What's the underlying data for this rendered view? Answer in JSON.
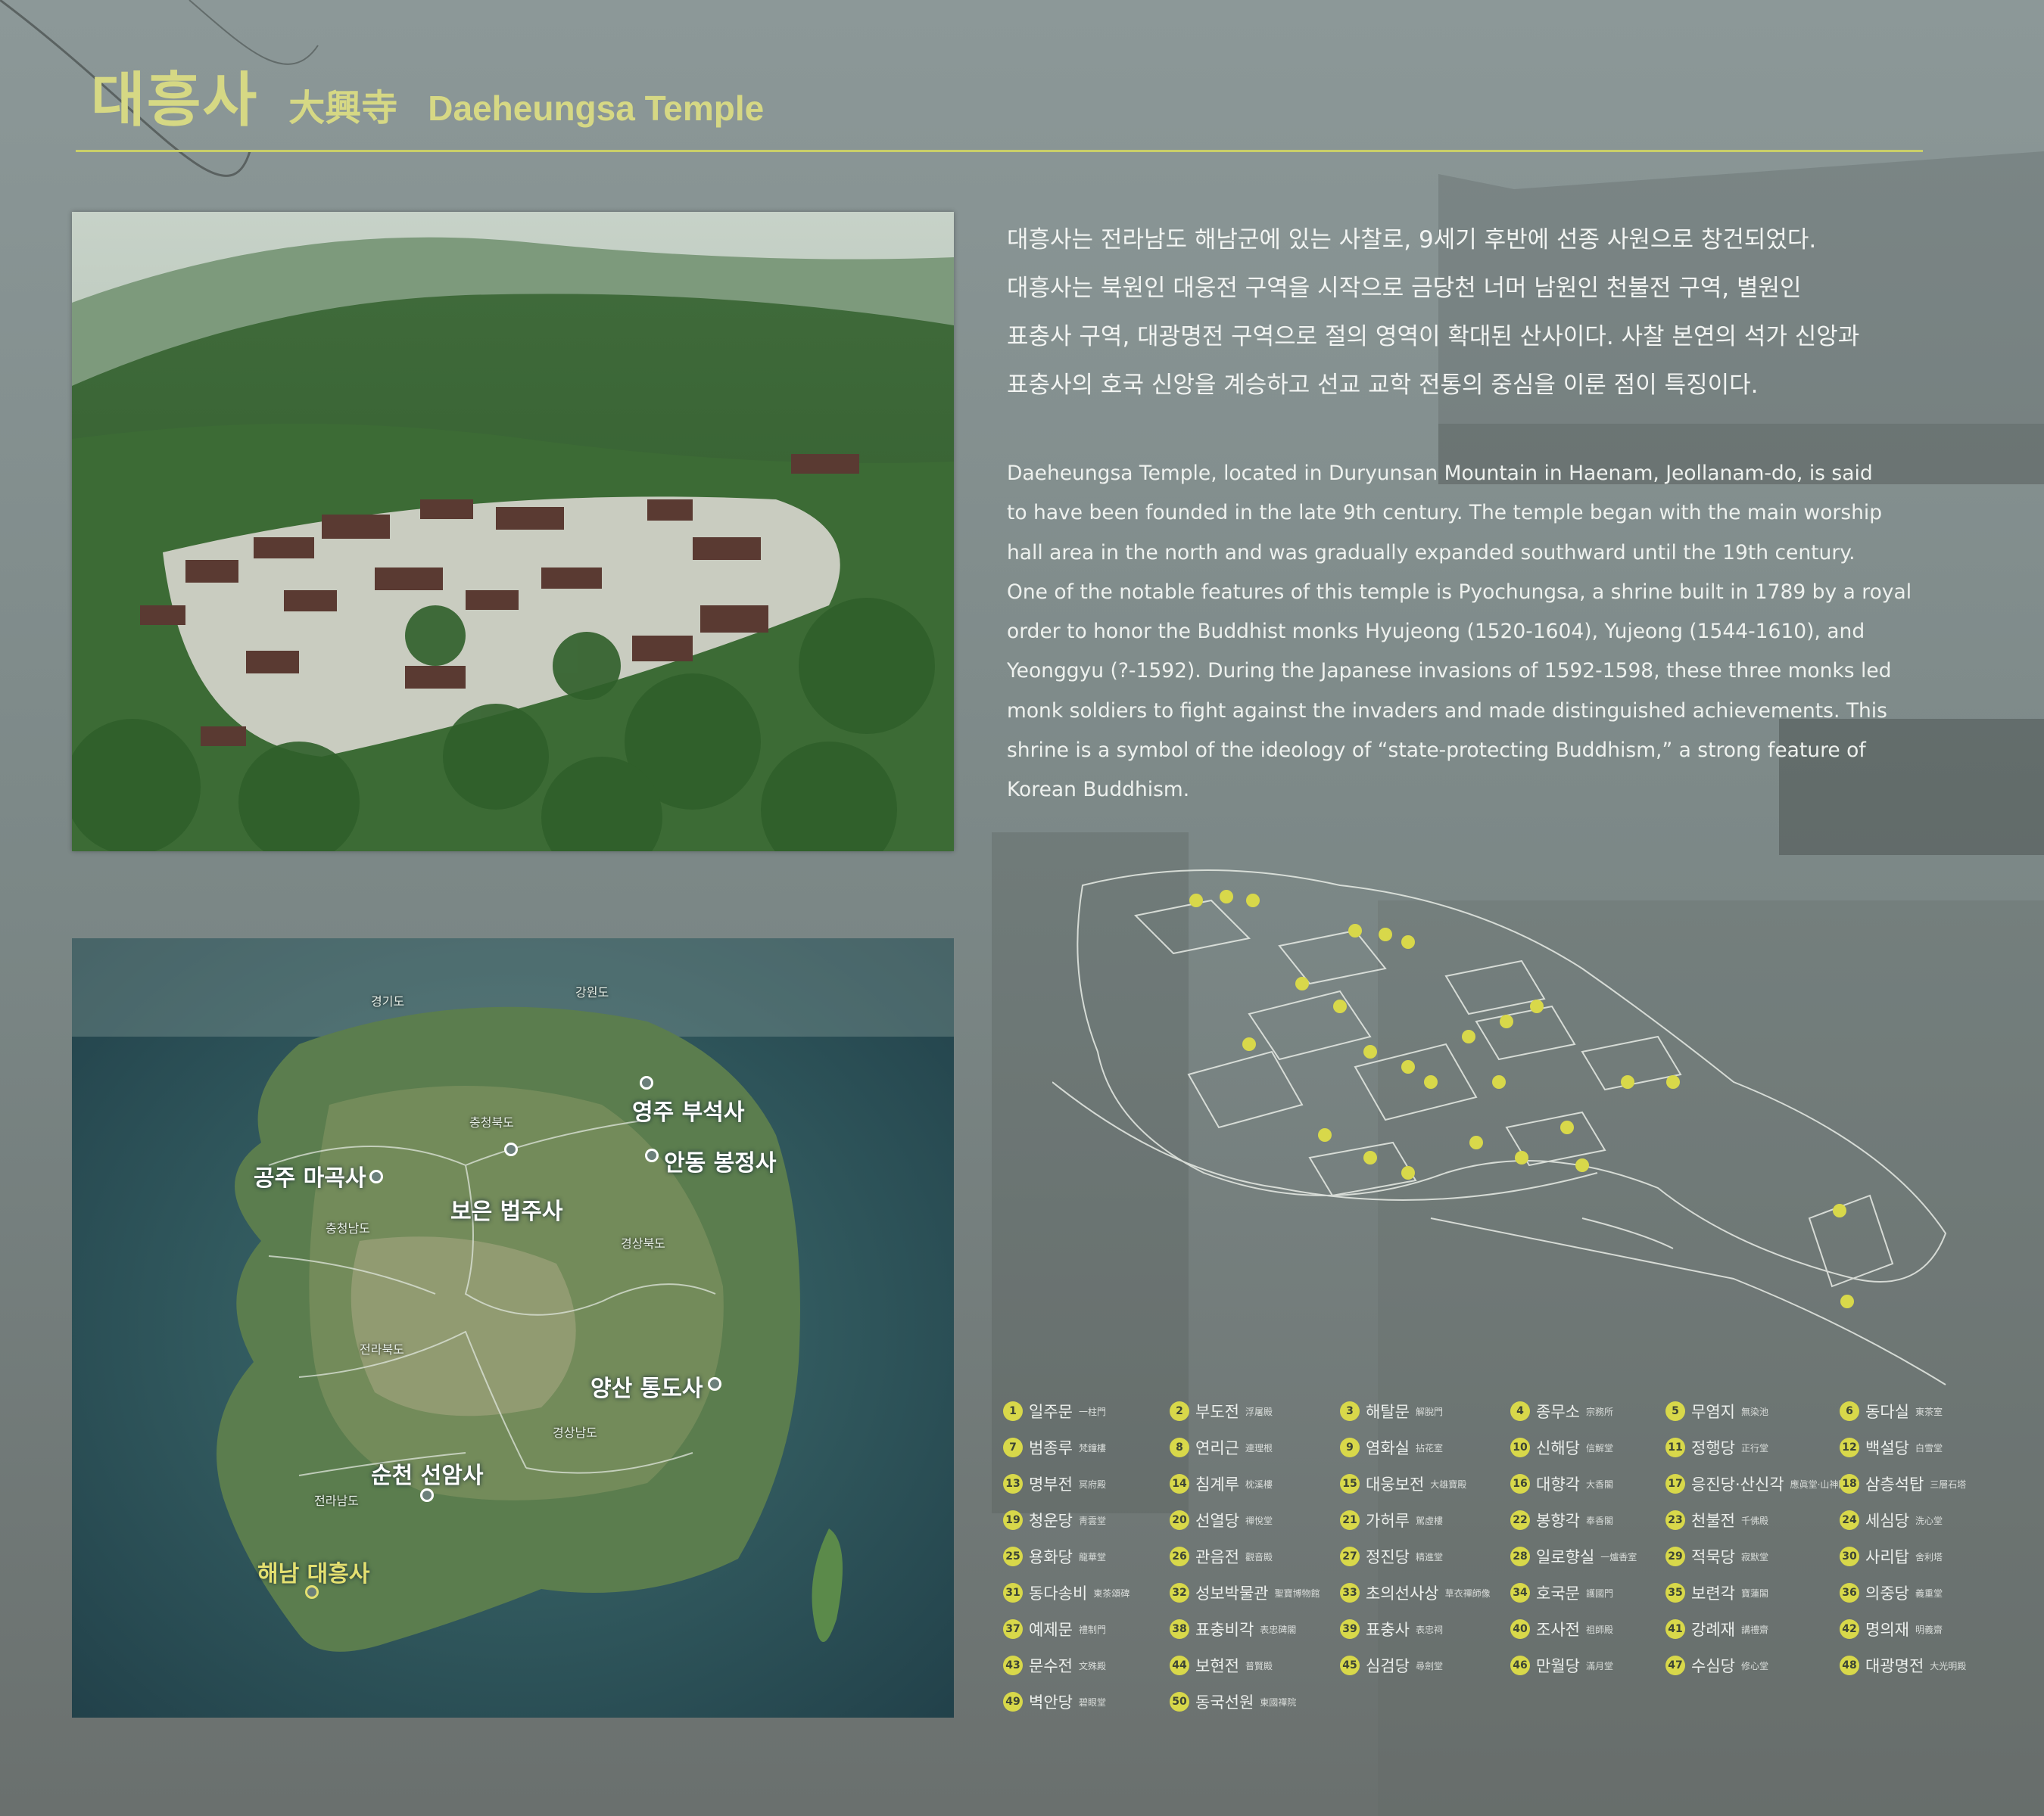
{
  "header": {
    "title_ko": "대흥사",
    "title_hanja": "大興寺",
    "title_en": "Daeheungsa Temple"
  },
  "description": {
    "ko_lines": [
      "대흥사는 전라남도 해남군에 있는 사찰로, 9세기 후반에 선종 사원으로 창건되었다.",
      "대흥사는 북원인 대웅전 구역을 시작으로 금당천 너머 남원인 천불전 구역, 별원인",
      "표충사 구역, 대광명전 구역으로 절의 영역이 확대된 산사이다. 사찰 본연의 석가 신앙과",
      "표충사의 호국 신앙을 계승하고 선교 교학 전통의 중심을 이룬 점이 특징이다."
    ],
    "en_lines": [
      "Daeheungsa Temple, located in Duryunsan Mountain in Haenam, Jeollanam-do, is said",
      "to have been founded in the late 9th century. The temple began with the main worship",
      "hall area in the north and was gradually expanded southward until the 19th century.",
      "One of the notable features of this temple is Pyochungsa, a shrine built in 1789 by a royal",
      "order to honor the Buddhist monks Hyujeong (1520-1604), Yujeong (1544-1610), and",
      "Yeonggyu (?-1592). During the Japanese invasions of 1592-1598, these three monks led",
      "monk soldiers to fight against the invaders and made distinguished achievements. This",
      "shrine is a symbol of the ideology of “state-protecting Buddhism,” a strong feature of",
      "Korean Buddhism."
    ]
  },
  "map": {
    "provinces": [
      "경기도",
      "강원도",
      "충청북도",
      "충청남도",
      "경상북도",
      "전라북도",
      "경상남도",
      "전라남도"
    ],
    "temples": [
      "영주 부석사",
      "공주 마곡사",
      "안동 봉정사",
      "보은 법주사",
      "양산 통도사",
      "순천 선암사",
      "해남 대흥사"
    ]
  },
  "legend": [
    {
      "num": "1",
      "name": "일주문",
      "hanja": "一柱門"
    },
    {
      "num": "2",
      "name": "부도전",
      "hanja": "浮屠殿"
    },
    {
      "num": "3",
      "name": "해탈문",
      "hanja": "解脫門"
    },
    {
      "num": "4",
      "name": "종무소",
      "hanja": "宗務所"
    },
    {
      "num": "5",
      "name": "무염지",
      "hanja": "無染池"
    },
    {
      "num": "6",
      "name": "동다실",
      "hanja": "東茶室"
    },
    {
      "num": "7",
      "name": "범종루",
      "hanja": "梵鐘樓"
    },
    {
      "num": "8",
      "name": "연리근",
      "hanja": "連理根"
    },
    {
      "num": "9",
      "name": "염화실",
      "hanja": "拈花室"
    },
    {
      "num": "10",
      "name": "신해당",
      "hanja": "信解堂"
    },
    {
      "num": "11",
      "name": "정행당",
      "hanja": "正行堂"
    },
    {
      "num": "12",
      "name": "백설당",
      "hanja": "白雪堂"
    },
    {
      "num": "13",
      "name": "명부전",
      "hanja": "冥府殿"
    },
    {
      "num": "14",
      "name": "침계루",
      "hanja": "枕溪樓"
    },
    {
      "num": "15",
      "name": "대웅보전",
      "hanja": "大雄寶殿"
    },
    {
      "num": "16",
      "name": "대향각",
      "hanja": "大香閣"
    },
    {
      "num": "17",
      "name": "응진당·산신각",
      "hanja": "應眞堂·山神閣"
    },
    {
      "num": "18",
      "name": "삼층석탑",
      "hanja": "三層石塔"
    },
    {
      "num": "19",
      "name": "청운당",
      "hanja": "靑雲堂"
    },
    {
      "num": "20",
      "name": "선열당",
      "hanja": "禪悅堂"
    },
    {
      "num": "21",
      "name": "가허루",
      "hanja": "駕虛樓"
    },
    {
      "num": "22",
      "name": "봉향각",
      "hanja": "奉香閣"
    },
    {
      "num": "23",
      "name": "천불전",
      "hanja": "千佛殿"
    },
    {
      "num": "24",
      "name": "세심당",
      "hanja": "洗心堂"
    },
    {
      "num": "25",
      "name": "용화당",
      "hanja": "龍華堂"
    },
    {
      "num": "26",
      "name": "관음전",
      "hanja": "觀音殿"
    },
    {
      "num": "27",
      "name": "정진당",
      "hanja": "精進堂"
    },
    {
      "num": "28",
      "name": "일로향실",
      "hanja": "一爐香室"
    },
    {
      "num": "29",
      "name": "적묵당",
      "hanja": "寂默堂"
    },
    {
      "num": "30",
      "name": "사리탑",
      "hanja": "舍利塔"
    },
    {
      "num": "31",
      "name": "동다송비",
      "hanja": "東茶頌碑"
    },
    {
      "num": "32",
      "name": "성보박물관",
      "hanja": "聖寶博物館"
    },
    {
      "num": "33",
      "name": "초의선사상",
      "hanja": "草衣禪師像"
    },
    {
      "num": "34",
      "name": "호국문",
      "hanja": "護國門"
    },
    {
      "num": "35",
      "name": "보련각",
      "hanja": "寶蓮閣"
    },
    {
      "num": "36",
      "name": "의중당",
      "hanja": "義重堂"
    },
    {
      "num": "37",
      "name": "예제문",
      "hanja": "禮制門"
    },
    {
      "num": "38",
      "name": "표충비각",
      "hanja": "表忠碑閣"
    },
    {
      "num": "39",
      "name": "표충사",
      "hanja": "表忠祠"
    },
    {
      "num": "40",
      "name": "조사전",
      "hanja": "祖師殿"
    },
    {
      "num": "41",
      "name": "강례재",
      "hanja": "講禮齋"
    },
    {
      "num": "42",
      "name": "명의재",
      "hanja": "明義齋"
    },
    {
      "num": "43",
      "name": "문수전",
      "hanja": "文殊殿"
    },
    {
      "num": "44",
      "name": "보현전",
      "hanja": "普賢殿"
    },
    {
      "num": "45",
      "name": "심검당",
      "hanja": "尋劍堂"
    },
    {
      "num": "46",
      "name": "만월당",
      "hanja": "滿月堂"
    },
    {
      "num": "47",
      "name": "수심당",
      "hanja": "修心堂"
    },
    {
      "num": "48",
      "name": "대광명전",
      "hanja": "大光明殿"
    },
    {
      "num": "49",
      "name": "벽안당",
      "hanja": "碧眼堂"
    },
    {
      "num": "50",
      "name": "동국선원",
      "hanja": "東國禪院"
    }
  ]
}
